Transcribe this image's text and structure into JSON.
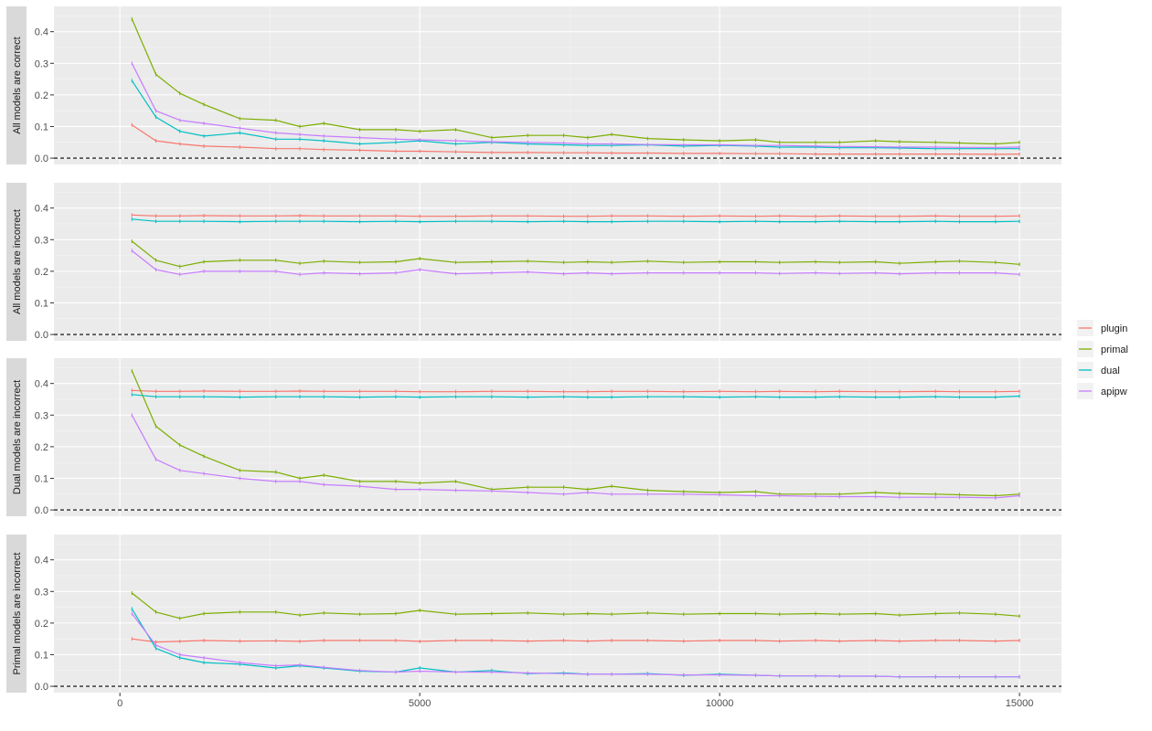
{
  "chart_data": {
    "type": "line",
    "xlim": [
      -1100,
      15700
    ],
    "ylim": [
      -0.02,
      0.48
    ],
    "x_ticks": [
      0,
      5000,
      10000,
      15000
    ],
    "y_ticks": [
      0.0,
      0.1,
      0.2,
      0.3,
      0.4
    ],
    "y_tick_labels": [
      "0.0",
      "0.1",
      "0.2",
      "0.3",
      "0.4"
    ],
    "grid": true,
    "reference_line": {
      "y": 0,
      "style": "dashed"
    },
    "legend_position": "right",
    "series_colors": {
      "plugin": "#F8766D",
      "primal": "#7CAE00",
      "dual": "#00BFC4",
      "apipw": "#C77CFF"
    },
    "legend": [
      "plugin",
      "primal",
      "dual",
      "apipw"
    ],
    "x": [
      200,
      600,
      1000,
      1400,
      2000,
      2600,
      3000,
      3400,
      4000,
      4600,
      5000,
      5600,
      6200,
      6800,
      7400,
      7800,
      8200,
      8800,
      9400,
      10000,
      10600,
      11000,
      11600,
      12000,
      12600,
      13000,
      13600,
      14000,
      14600,
      15000
    ],
    "panels": [
      {
        "strip": "All models are correct",
        "series": [
          {
            "name": "plugin",
            "values": [
              0.105,
              0.055,
              0.045,
              0.038,
              0.035,
              0.03,
              0.03,
              0.027,
              0.025,
              0.022,
              0.022,
              0.02,
              0.018,
              0.018,
              0.017,
              0.017,
              0.016,
              0.016,
              0.015,
              0.015,
              0.014,
              0.014,
              0.013,
              0.013,
              0.013,
              0.013,
              0.013,
              0.013,
              0.012,
              0.013
            ]
          },
          {
            "name": "primal",
            "values": [
              0.44,
              0.265,
              0.205,
              0.17,
              0.125,
              0.12,
              0.1,
              0.11,
              0.09,
              0.09,
              0.085,
              0.09,
              0.065,
              0.072,
              0.072,
              0.065,
              0.075,
              0.062,
              0.058,
              0.055,
              0.058,
              0.05,
              0.05,
              0.05,
              0.055,
              0.052,
              0.05,
              0.048,
              0.045,
              0.05
            ]
          },
          {
            "name": "dual",
            "values": [
              0.245,
              0.13,
              0.085,
              0.07,
              0.08,
              0.06,
              0.06,
              0.055,
              0.045,
              0.05,
              0.055,
              0.045,
              0.05,
              0.045,
              0.042,
              0.04,
              0.04,
              0.042,
              0.038,
              0.04,
              0.038,
              0.035,
              0.035,
              0.033,
              0.033,
              0.032,
              0.03,
              0.03,
              0.03,
              0.03
            ]
          },
          {
            "name": "apipw",
            "values": [
              0.3,
              0.15,
              0.12,
              0.11,
              0.095,
              0.08,
              0.075,
              0.07,
              0.065,
              0.06,
              0.058,
              0.055,
              0.052,
              0.05,
              0.048,
              0.045,
              0.045,
              0.043,
              0.042,
              0.042,
              0.04,
              0.04,
              0.038,
              0.037,
              0.036,
              0.035,
              0.035,
              0.034,
              0.034,
              0.035
            ]
          }
        ]
      },
      {
        "strip": "All models are incorrect",
        "series": [
          {
            "name": "plugin",
            "values": [
              0.378,
              0.375,
              0.375,
              0.376,
              0.375,
              0.375,
              0.376,
              0.375,
              0.375,
              0.375,
              0.374,
              0.374,
              0.375,
              0.375,
              0.374,
              0.374,
              0.375,
              0.375,
              0.374,
              0.375,
              0.374,
              0.375,
              0.374,
              0.375,
              0.374,
              0.374,
              0.375,
              0.374,
              0.374,
              0.375
            ]
          },
          {
            "name": "primal",
            "values": [
              0.295,
              0.235,
              0.215,
              0.23,
              0.235,
              0.235,
              0.225,
              0.232,
              0.228,
              0.23,
              0.24,
              0.228,
              0.23,
              0.232,
              0.228,
              0.23,
              0.228,
              0.232,
              0.228,
              0.23,
              0.23,
              0.228,
              0.23,
              0.228,
              0.23,
              0.225,
              0.23,
              0.232,
              0.228,
              0.222
            ]
          },
          {
            "name": "dual",
            "values": [
              0.365,
              0.358,
              0.358,
              0.358,
              0.357,
              0.358,
              0.358,
              0.358,
              0.357,
              0.358,
              0.357,
              0.358,
              0.358,
              0.357,
              0.358,
              0.357,
              0.357,
              0.358,
              0.358,
              0.357,
              0.358,
              0.357,
              0.357,
              0.358,
              0.357,
              0.357,
              0.358,
              0.357,
              0.357,
              0.358
            ]
          },
          {
            "name": "apipw",
            "values": [
              0.265,
              0.205,
              0.19,
              0.2,
              0.2,
              0.2,
              0.19,
              0.195,
              0.192,
              0.195,
              0.205,
              0.192,
              0.195,
              0.198,
              0.192,
              0.195,
              0.192,
              0.195,
              0.195,
              0.195,
              0.195,
              0.193,
              0.195,
              0.193,
              0.195,
              0.192,
              0.195,
              0.195,
              0.195,
              0.19
            ]
          }
        ]
      },
      {
        "strip": "Dual models are incorrect",
        "series": [
          {
            "name": "plugin",
            "values": [
              0.378,
              0.375,
              0.375,
              0.376,
              0.375,
              0.375,
              0.376,
              0.375,
              0.375,
              0.375,
              0.374,
              0.374,
              0.375,
              0.375,
              0.374,
              0.374,
              0.375,
              0.375,
              0.374,
              0.375,
              0.374,
              0.375,
              0.374,
              0.375,
              0.374,
              0.374,
              0.375,
              0.374,
              0.374,
              0.375
            ]
          },
          {
            "name": "primal",
            "values": [
              0.44,
              0.265,
              0.205,
              0.17,
              0.125,
              0.12,
              0.1,
              0.11,
              0.09,
              0.09,
              0.085,
              0.09,
              0.065,
              0.072,
              0.072,
              0.065,
              0.075,
              0.062,
              0.058,
              0.055,
              0.058,
              0.05,
              0.05,
              0.05,
              0.055,
              0.052,
              0.05,
              0.048,
              0.045,
              0.05
            ]
          },
          {
            "name": "dual",
            "values": [
              0.365,
              0.358,
              0.358,
              0.358,
              0.357,
              0.358,
              0.358,
              0.358,
              0.357,
              0.358,
              0.357,
              0.358,
              0.358,
              0.357,
              0.358,
              0.357,
              0.357,
              0.358,
              0.358,
              0.357,
              0.358,
              0.357,
              0.357,
              0.358,
              0.357,
              0.357,
              0.358,
              0.357,
              0.357,
              0.36
            ]
          },
          {
            "name": "apipw",
            "values": [
              0.3,
              0.16,
              0.125,
              0.115,
              0.1,
              0.09,
              0.09,
              0.08,
              0.075,
              0.065,
              0.065,
              0.062,
              0.06,
              0.055,
              0.05,
              0.055,
              0.05,
              0.05,
              0.05,
              0.048,
              0.045,
              0.045,
              0.043,
              0.042,
              0.042,
              0.04,
              0.04,
              0.04,
              0.038,
              0.045
            ]
          }
        ]
      },
      {
        "strip": "Primal models are incorrect",
        "series": [
          {
            "name": "plugin",
            "values": [
              0.15,
              0.14,
              0.142,
              0.145,
              0.143,
              0.144,
              0.142,
              0.145,
              0.145,
              0.145,
              0.142,
              0.145,
              0.145,
              0.143,
              0.145,
              0.143,
              0.145,
              0.145,
              0.143,
              0.145,
              0.145,
              0.143,
              0.145,
              0.143,
              0.145,
              0.143,
              0.145,
              0.145,
              0.143,
              0.145
            ]
          },
          {
            "name": "primal",
            "values": [
              0.295,
              0.235,
              0.215,
              0.23,
              0.235,
              0.235,
              0.225,
              0.232,
              0.228,
              0.23,
              0.24,
              0.228,
              0.23,
              0.232,
              0.228,
              0.23,
              0.228,
              0.232,
              0.228,
              0.23,
              0.23,
              0.228,
              0.23,
              0.228,
              0.23,
              0.225,
              0.23,
              0.232,
              0.228,
              0.222
            ]
          },
          {
            "name": "dual",
            "values": [
              0.245,
              0.12,
              0.09,
              0.075,
              0.07,
              0.058,
              0.065,
              0.058,
              0.048,
              0.045,
              0.058,
              0.045,
              0.05,
              0.04,
              0.042,
              0.038,
              0.038,
              0.04,
              0.035,
              0.038,
              0.035,
              0.033,
              0.033,
              0.032,
              0.032,
              0.03,
              0.03,
              0.03,
              0.03,
              0.03
            ]
          },
          {
            "name": "apipw",
            "values": [
              0.23,
              0.13,
              0.1,
              0.09,
              0.075,
              0.065,
              0.068,
              0.06,
              0.05,
              0.045,
              0.048,
              0.045,
              0.045,
              0.042,
              0.04,
              0.038,
              0.038,
              0.038,
              0.036,
              0.036,
              0.035,
              0.033,
              0.033,
              0.032,
              0.032,
              0.03,
              0.03,
              0.03,
              0.03,
              0.03
            ]
          }
        ]
      }
    ]
  }
}
